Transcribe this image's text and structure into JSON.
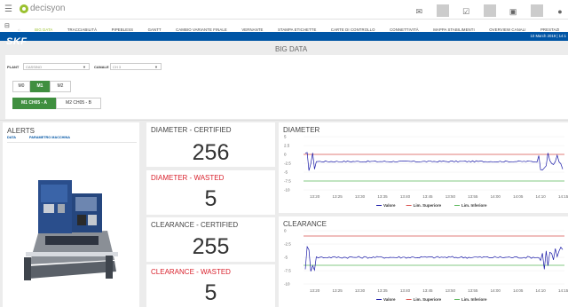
{
  "app": {
    "name": "decisyon"
  },
  "nav": {
    "tabs": [
      {
        "label": "BIG DATA",
        "active": true
      },
      {
        "label": "TRACCIABILITÀ"
      },
      {
        "label": "PIPEBLESS"
      },
      {
        "label": "GANTT"
      },
      {
        "label": "CAMBIO VARIANTE FINALE"
      },
      {
        "label": "VERNANTE"
      },
      {
        "label": "STAMPA ETICHETTE"
      },
      {
        "label": "CARTE DI CONTROLLO"
      },
      {
        "label": "CONNETTIVITÀ"
      },
      {
        "label": "MAPPA STABILIMENTI"
      },
      {
        "label": "OVERVIEW CANALI"
      },
      {
        "label": "PRESTAZI"
      }
    ]
  },
  "header": {
    "brand": "SKF",
    "date": "10 March 2019 | 14:1",
    "title": "BIG DATA"
  },
  "filters": {
    "plant_label": "PLANT",
    "plant_value": "CASSINO",
    "canale_label": "CANALE",
    "canale_value": "CH 3",
    "machines": [
      {
        "label": "M0",
        "active": false
      },
      {
        "label": "M1",
        "active": true
      },
      {
        "label": "M2",
        "active": false
      }
    ],
    "channels": [
      {
        "label": "M1  CH05 - A",
        "active": true
      },
      {
        "label": "M2  CH05 - B",
        "active": false
      }
    ]
  },
  "alerts": {
    "title": "ALERTS",
    "tab_data": "DATA",
    "tab_param": "PARAMETRO MACCHINA"
  },
  "kpis": {
    "diameter_certified": {
      "label": "DIAMETER - CERTIFIED",
      "value": "256"
    },
    "diameter_wasted": {
      "label": "DIAMETER - WASTED",
      "value": "5"
    },
    "clearance_certified": {
      "label": "CLEARANCE - CERTIFIED",
      "value": "255"
    },
    "clearance_wasted": {
      "label": "CLEARANCE - WASTED",
      "value": "5"
    }
  },
  "colors": {
    "valore": "#1a1aa8",
    "superiore": "#d9534f",
    "inferiore": "#5cb85c",
    "wasted": "#d9232e"
  },
  "chart_data": [
    {
      "type": "line",
      "title": "DIAMETER",
      "x": [
        "13:20",
        "13:25",
        "13:30",
        "13:35",
        "13:40",
        "13:45",
        "13:50",
        "13:55",
        "14:00",
        "14:05",
        "14:10",
        "14:15"
      ],
      "yticks": [
        "5",
        "2.5",
        "0",
        "-2.5",
        "-5",
        "-7.5",
        "-10"
      ],
      "ylim": [
        -10,
        5
      ],
      "series": [
        {
          "name": "Valore",
          "color": "#1a1aa8",
          "base": -2,
          "noise_start": 0.2,
          "noise_end": 0.3
        },
        {
          "name": "Lim. Superiore",
          "color": "#d9534f",
          "value": 0
        },
        {
          "name": "Lim. Inferiore",
          "color": "#5cb85c",
          "value": -7.5
        }
      ],
      "legend": "bottom"
    },
    {
      "type": "line",
      "title": "CLEARANCE",
      "x": [
        "13:20",
        "13:25",
        "13:30",
        "13:35",
        "13:40",
        "13:45",
        "13:50",
        "13:55",
        "14:00",
        "14:05",
        "14:10",
        "14:15"
      ],
      "yticks": [
        "0",
        "-2.5",
        "-5",
        "-7.5",
        "-10"
      ],
      "ylim": [
        -10,
        0
      ],
      "series": [
        {
          "name": "Valore",
          "color": "#1a1aa8",
          "base": -5,
          "noise_start": 0.4,
          "noise_end": 0.5
        },
        {
          "name": "Lim. Superiore",
          "color": "#d9534f",
          "value": -1
        },
        {
          "name": "Lim. Inferiore",
          "color": "#5cb85c",
          "value": -6.5
        }
      ],
      "legend": "bottom"
    }
  ]
}
